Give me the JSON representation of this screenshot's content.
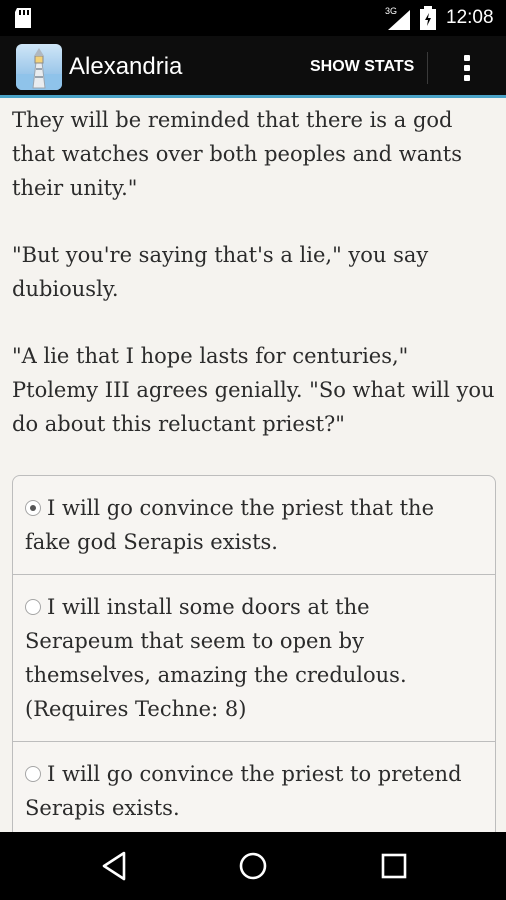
{
  "status_bar": {
    "network": "3G",
    "time": "12:08"
  },
  "app_bar": {
    "title": "Alexandria",
    "show_stats_label": "SHOW STATS"
  },
  "story": {
    "paragraphs": [
      "They will be reminded that there is a god that watches over both peoples and wants their unity.\"",
      "\"But you're saying that's a lie,\" you say dubiously.",
      "\"A lie that I hope lasts for centuries,\" Ptolemy III agrees genially. \"So what will you do about this reluctant priest?\""
    ]
  },
  "choices": [
    {
      "label": "I will go convince the priest that the fake god Serapis exists.",
      "selected": true
    },
    {
      "label": "I will install some doors at the Serapeum that seem to open by themselves, amazing the credulous. (Requires Techne: 8)",
      "selected": false
    },
    {
      "label": "I will go convince the priest to pretend Serapis exists.",
      "selected": false
    }
  ],
  "nav_bar": {
    "icons": [
      "back-icon",
      "home-icon",
      "recents-icon"
    ]
  },
  "colors": {
    "accent": "#4aa3c7",
    "app_bar": "#0d0d0d",
    "background": "#f5f3ef"
  }
}
